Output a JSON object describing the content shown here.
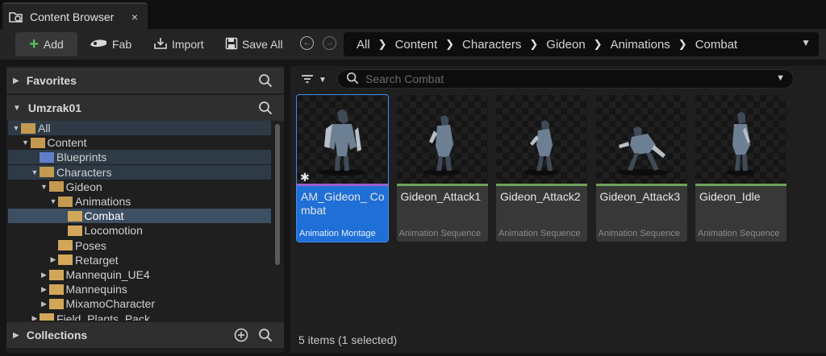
{
  "tab": {
    "title": "Content Browser",
    "close": "×"
  },
  "toolbar": {
    "add_label": "Add",
    "fab_label": "Fab",
    "import_label": "Import",
    "save_all_label": "Save All"
  },
  "breadcrumb": [
    "All",
    "Content",
    "Characters",
    "Gideon",
    "Animations",
    "Combat"
  ],
  "left": {
    "favorites": "Favorites",
    "project": "Umzrak01",
    "collections": "Collections",
    "tree": [
      {
        "label": "All",
        "depth": 0,
        "state": "open",
        "color": "open",
        "style": "hl"
      },
      {
        "label": "Content",
        "depth": 1,
        "state": "open",
        "color": "open",
        "style": ""
      },
      {
        "label": "Blueprints",
        "depth": 2,
        "state": "none",
        "color": "blue",
        "style": "hl"
      },
      {
        "label": "Characters",
        "depth": 2,
        "state": "open",
        "color": "open",
        "style": "hl"
      },
      {
        "label": "Gideon",
        "depth": 3,
        "state": "open",
        "color": "open",
        "style": ""
      },
      {
        "label": "Animations",
        "depth": 4,
        "state": "open",
        "color": "open",
        "style": ""
      },
      {
        "label": "Combat",
        "depth": 5,
        "state": "none",
        "color": "closed",
        "style": "sel"
      },
      {
        "label": "Locomotion",
        "depth": 5,
        "state": "none",
        "color": "closed",
        "style": ""
      },
      {
        "label": "Poses",
        "depth": 4,
        "state": "none",
        "color": "closed",
        "style": ""
      },
      {
        "label": "Retarget",
        "depth": 4,
        "state": "closed",
        "color": "closed",
        "style": ""
      },
      {
        "label": "Mannequin_UE4",
        "depth": 3,
        "state": "closed",
        "color": "closed",
        "style": ""
      },
      {
        "label": "Mannequins",
        "depth": 3,
        "state": "closed",
        "color": "closed",
        "style": ""
      },
      {
        "label": "MixamoCharacter",
        "depth": 3,
        "state": "closed",
        "color": "closed",
        "style": ""
      },
      {
        "label": "Field_Plants_Pack",
        "depth": 2,
        "state": "closed",
        "color": "closed",
        "style": ""
      }
    ]
  },
  "search": {
    "placeholder": "Search Combat"
  },
  "assets": [
    {
      "name": "AM_Gideon_ Combat",
      "type": "Animation Montage",
      "selected": true,
      "strip": "purple",
      "pose": "stand"
    },
    {
      "name": "Gideon_Attack1",
      "type": "Animation Sequence",
      "selected": false,
      "strip": "green",
      "pose": "crouch"
    },
    {
      "name": "Gideon_Attack2",
      "type": "Animation Sequence",
      "selected": false,
      "strip": "green",
      "pose": "lean"
    },
    {
      "name": "Gideon_Attack3",
      "type": "Animation Sequence",
      "selected": false,
      "strip": "green",
      "pose": "lunge"
    },
    {
      "name": "Gideon_Idle",
      "type": "Animation Sequence",
      "selected": false,
      "strip": "green",
      "pose": "idle"
    }
  ],
  "status": "5 items (1 selected)",
  "icons": {
    "tab": "content-browser-icon",
    "add": "plus-icon",
    "fab": "fab-icon",
    "import": "import-icon",
    "save": "save-icon",
    "back": "back-arrow-icon",
    "forward": "forward-arrow-icon",
    "filter": "filter-icon",
    "search": "search-icon"
  }
}
